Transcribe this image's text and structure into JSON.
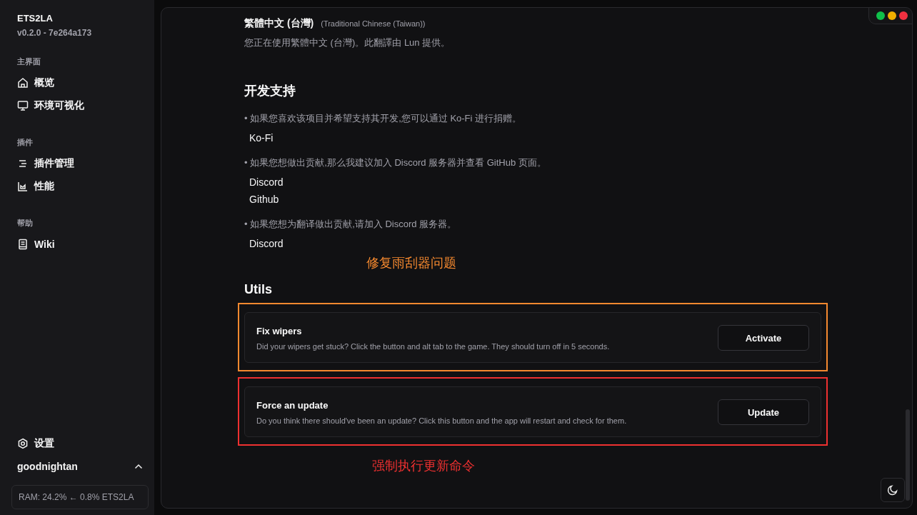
{
  "app": {
    "name": "ETS2LA",
    "version": "v0.2.0 - 7e264a173"
  },
  "window_controls": [
    {
      "color": "#10c04a"
    },
    {
      "color": "#f0b000"
    },
    {
      "color": "#f03040"
    }
  ],
  "sidebar": {
    "groups": [
      {
        "label": "主界面",
        "items": [
          {
            "label": "概览",
            "kind": "home"
          },
          {
            "label": "环境可视化",
            "kind": "monitor"
          }
        ]
      },
      {
        "label": "插件",
        "items": [
          {
            "label": "插件管理",
            "kind": "list"
          },
          {
            "label": "性能",
            "kind": "chart"
          }
        ]
      },
      {
        "label": "帮助",
        "items": [
          {
            "label": "Wiki",
            "kind": "book"
          }
        ]
      }
    ],
    "settings": {
      "label": "设置"
    },
    "user": {
      "name": "goodnightan"
    },
    "ram": "RAM: 24.2% ← 0.8% ETS2LA"
  },
  "language": {
    "name": "繁體中文 (台灣)",
    "english": "(Traditional Chinese (Taiwan))",
    "note": "您正在使用繁體中文 (台灣)。此翻譯由 Lun 提供。"
  },
  "support": {
    "title": "开发支持",
    "entries": [
      {
        "text": "• 如果您喜欢该项目并希望支持其开发,您可以通过 Ko-Fi 进行捐赠。",
        "links": [
          "Ko-Fi"
        ]
      },
      {
        "text": "• 如果您想做出贡献,那么我建议加入 Discord 服务器并查看 GitHub 页面。",
        "links": [
          "Discord",
          "Github"
        ]
      },
      {
        "text": "• 如果您想为翻译做出贡献,请加入 Discord 服务器。",
        "links": [
          "Discord"
        ]
      }
    ]
  },
  "utils": {
    "title": "Utils",
    "cards": [
      {
        "title": "Fix wipers",
        "description": "Did your wipers get stuck? Click the button and alt tab to the game. They should turn off in 5 seconds.",
        "button": "Activate",
        "annotation": {
          "label": "修复雨刮器问题",
          "color": "#f5892f",
          "kind": "above"
        }
      },
      {
        "title": "Force an update",
        "description": "Do you think there should've been an update? Click this button and the app will restart and check for them.",
        "button": "Update",
        "annotation": {
          "label": "强制执行更新命令",
          "color": "#ee3030",
          "kind": "below"
        }
      }
    ]
  }
}
